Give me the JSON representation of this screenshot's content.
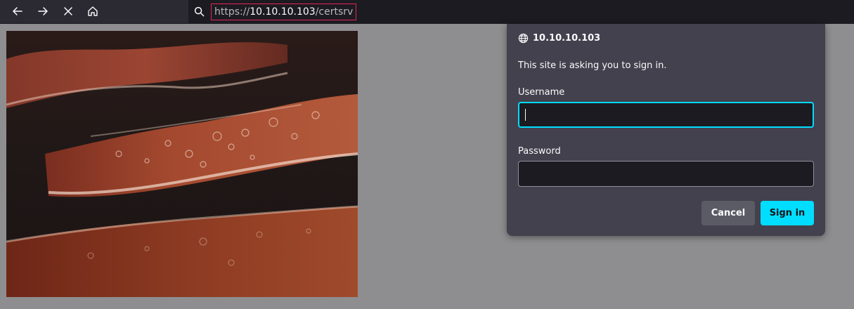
{
  "url": {
    "scheme": "https://",
    "host": "10.10.10.103",
    "path": "/certsrv"
  },
  "dialog": {
    "host": "10.10.10.103",
    "message": "This site is asking you to sign in.",
    "username_label": "Username",
    "username_value": "",
    "password_label": "Password",
    "password_value": "",
    "cancel_label": "Cancel",
    "signin_label": "Sign in"
  },
  "colors": {
    "accent": "#00ddff",
    "url_highlight_border": "#e22850",
    "toolbar": "#2b2a33",
    "dialog_bg": "#42414d"
  },
  "icons": [
    "back-icon",
    "forward-icon",
    "stop-icon",
    "home-icon",
    "search-icon",
    "globe-icon"
  ],
  "image": {
    "subject": "bacon"
  }
}
